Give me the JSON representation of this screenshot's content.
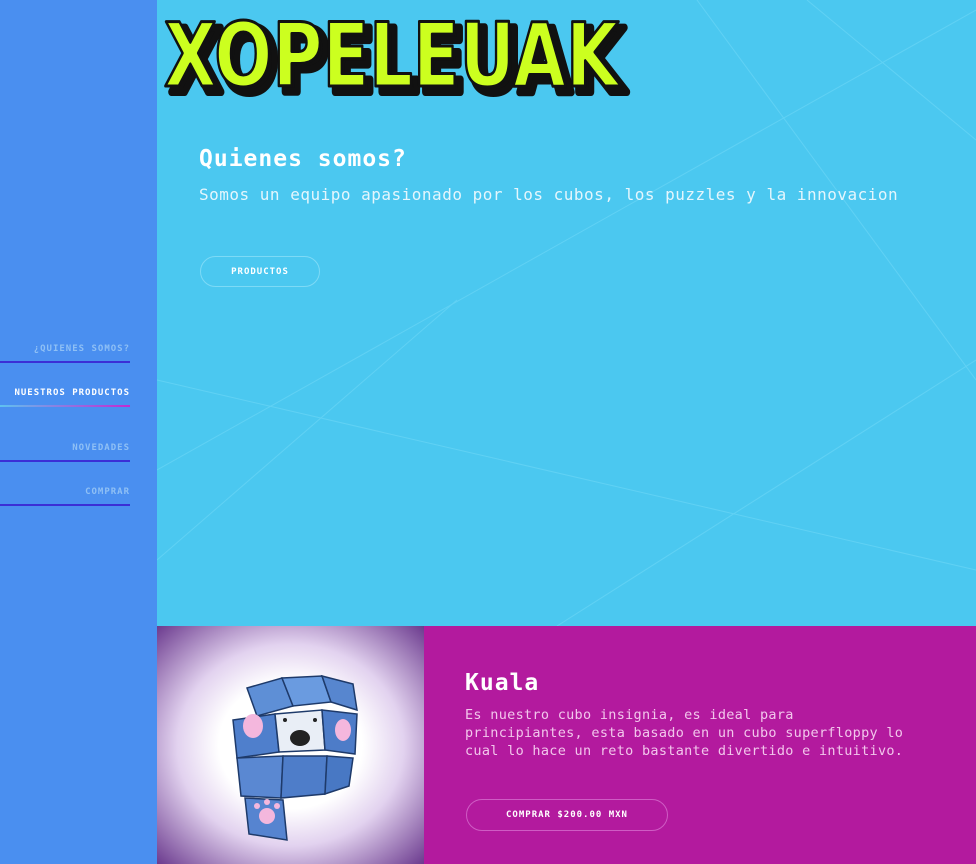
{
  "brand": {
    "logo_text": "XOPELEUAK"
  },
  "nav": {
    "items": [
      {
        "label": "¿Quienes somos?"
      },
      {
        "label": "Nuestros productos"
      },
      {
        "label": "Novedades"
      },
      {
        "label": "Comprar"
      }
    ]
  },
  "hero": {
    "title": "Quienes somos?",
    "description": "Somos un equipo apasionado por los cubos, los puzzles y la innovacion",
    "button_label": "Productos"
  },
  "product": {
    "name": "Kuala",
    "description": "Es nuestro cubo insignia, es ideal para principiantes, esta basado en un cubo superfloppy lo cual lo hace un reto bastante divertido e intuitivo.",
    "buy_label": "Comprar $200.00 MXN"
  },
  "colors": {
    "sidebar": "#4a8ff0",
    "hero_bg": "#4bc8f0",
    "product_bg": "#b31a9e",
    "logo_fill": "#ccff1f",
    "nav_underline": "#3b2fd6"
  }
}
